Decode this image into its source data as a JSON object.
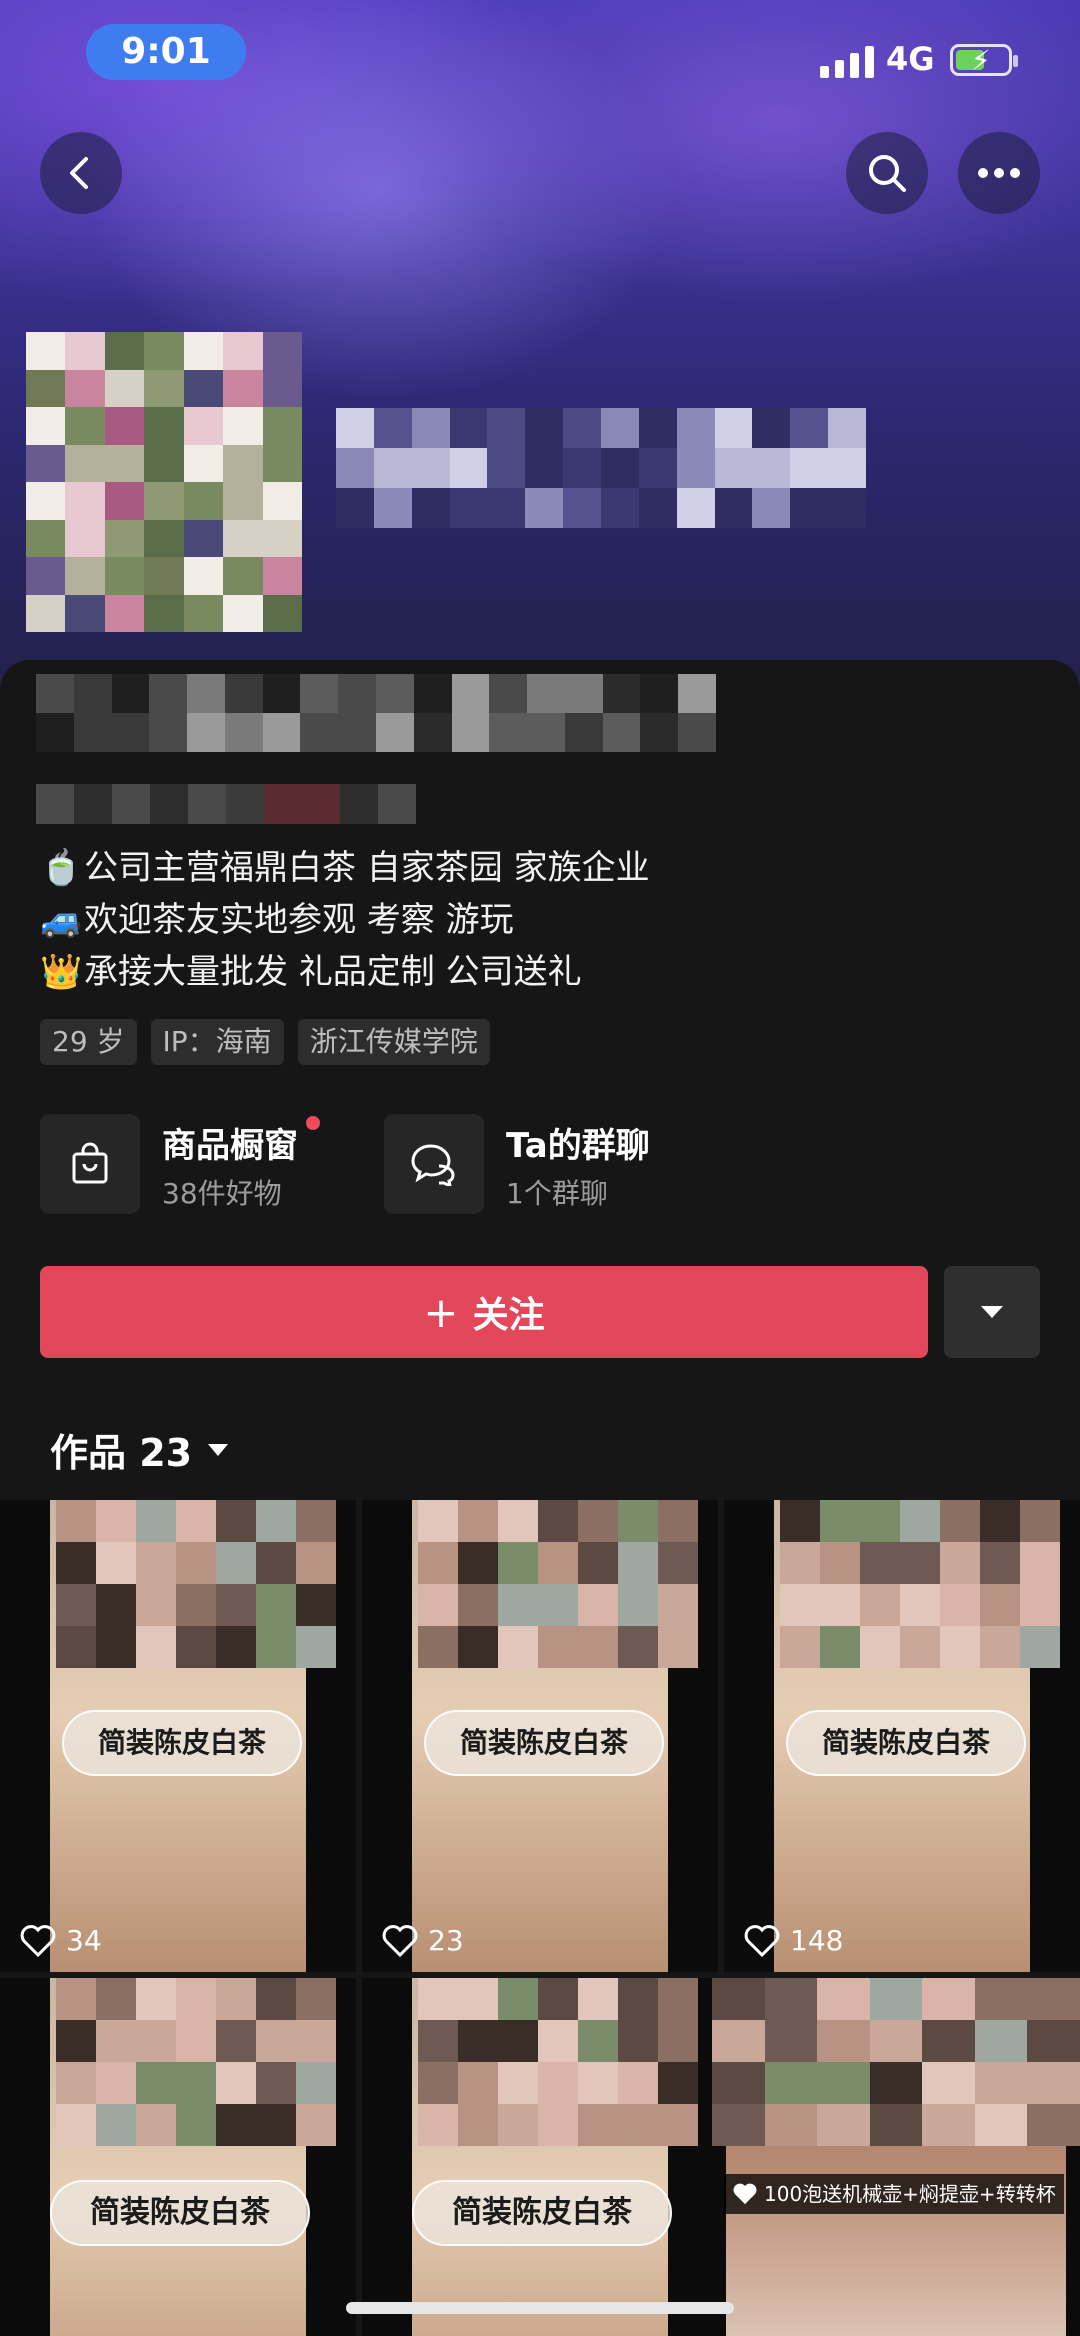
{
  "status_bar": {
    "time": "9:01",
    "network": "4G"
  },
  "nav": {
    "back_icon": "chevron-left-icon",
    "search_icon": "search-icon",
    "more_icon": "ellipsis-icon"
  },
  "bio": {
    "lines": [
      {
        "emoji": "🍵",
        "text": "公司主营福鼎白茶 自家茶园 家族企业"
      },
      {
        "emoji": "🚙",
        "text": "欢迎茶友实地参观 考察 游玩"
      },
      {
        "emoji": "👑",
        "text": "承接大量批发 礼品定制 公司送礼"
      }
    ]
  },
  "tags": {
    "age": "29 岁",
    "ip": "IP：海南",
    "school": "浙江传媒学院"
  },
  "shop": {
    "title": "商品橱窗",
    "subtitle": "38件好物",
    "icon": "shopping-bag-icon"
  },
  "group_chat": {
    "title": "Ta的群聊",
    "subtitle": "1个群聊",
    "icon": "chat-bubbles-icon"
  },
  "follow_button": {
    "label": "关注",
    "plus": "+"
  },
  "works": {
    "label": "作品 23"
  },
  "posts": [
    {
      "overlay": "简装陈皮白茶",
      "likes": "34"
    },
    {
      "overlay": "简装陈皮白茶",
      "likes": "23"
    },
    {
      "overlay": "简装陈皮白茶",
      "likes": "148"
    },
    {
      "overlay": "简装陈皮白茶",
      "likes": ""
    },
    {
      "overlay": "简装陈皮白茶",
      "likes": ""
    },
    {
      "overlay": "100泡送机械壶+焖提壶+转转杯",
      "likes": ""
    }
  ],
  "colors": {
    "accent": "#e3475a",
    "background": "#161616",
    "time_pill": "#3f7cf0"
  }
}
